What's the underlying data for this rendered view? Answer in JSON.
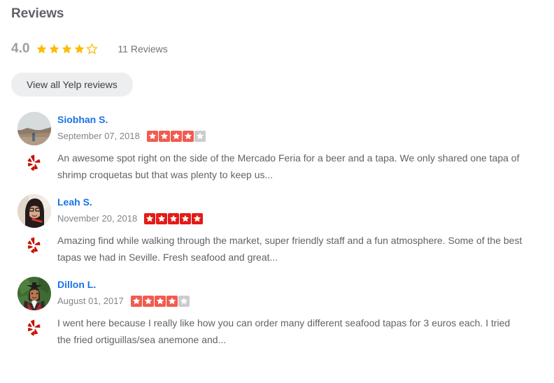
{
  "section": {
    "title": "Reviews"
  },
  "summary": {
    "rating_value": "4.0",
    "rating_stars_filled": 4,
    "rating_stars_total": 5,
    "review_count_label": "11 Reviews",
    "star_color": "#fbbc04"
  },
  "actions": {
    "view_all_label": "View all Yelp reviews"
  },
  "reviews": [
    {
      "name": "Siobhan S.",
      "date": "September 07, 2018",
      "stars": 4,
      "star_color": "#f15c4f",
      "star_empty_color": "#cccccc",
      "text": "An awesome spot right on the side of the Mercado Feria for a beer and a tapa. We only shared one tapa of shrimp croquetas but that was plenty to keep us...",
      "avatar": "landscape-desert-photo"
    },
    {
      "name": "Leah S.",
      "date": "November 20, 2018",
      "stars": 5,
      "star_color": "#e31b17",
      "star_empty_color": "#cccccc",
      "text": "Amazing find while walking through the market, super friendly staff and a fun atmosphere. Some of the best tapas we had in Seville. Fresh seafood and great...",
      "avatar": "woman-with-glasses-photo"
    },
    {
      "name": "Dillon L.",
      "date": "August 01, 2017",
      "stars": 4,
      "star_color": "#f15c4f",
      "star_empty_color": "#cccccc",
      "text": "I went here because I really like how you can order many different seafood tapas for 3 euros each. I tried the fried ortiguillas/sea anemone and...",
      "avatar": "graduation-portrait-photo"
    }
  ],
  "branding": {
    "yelp_burst_color": "#c41200"
  }
}
